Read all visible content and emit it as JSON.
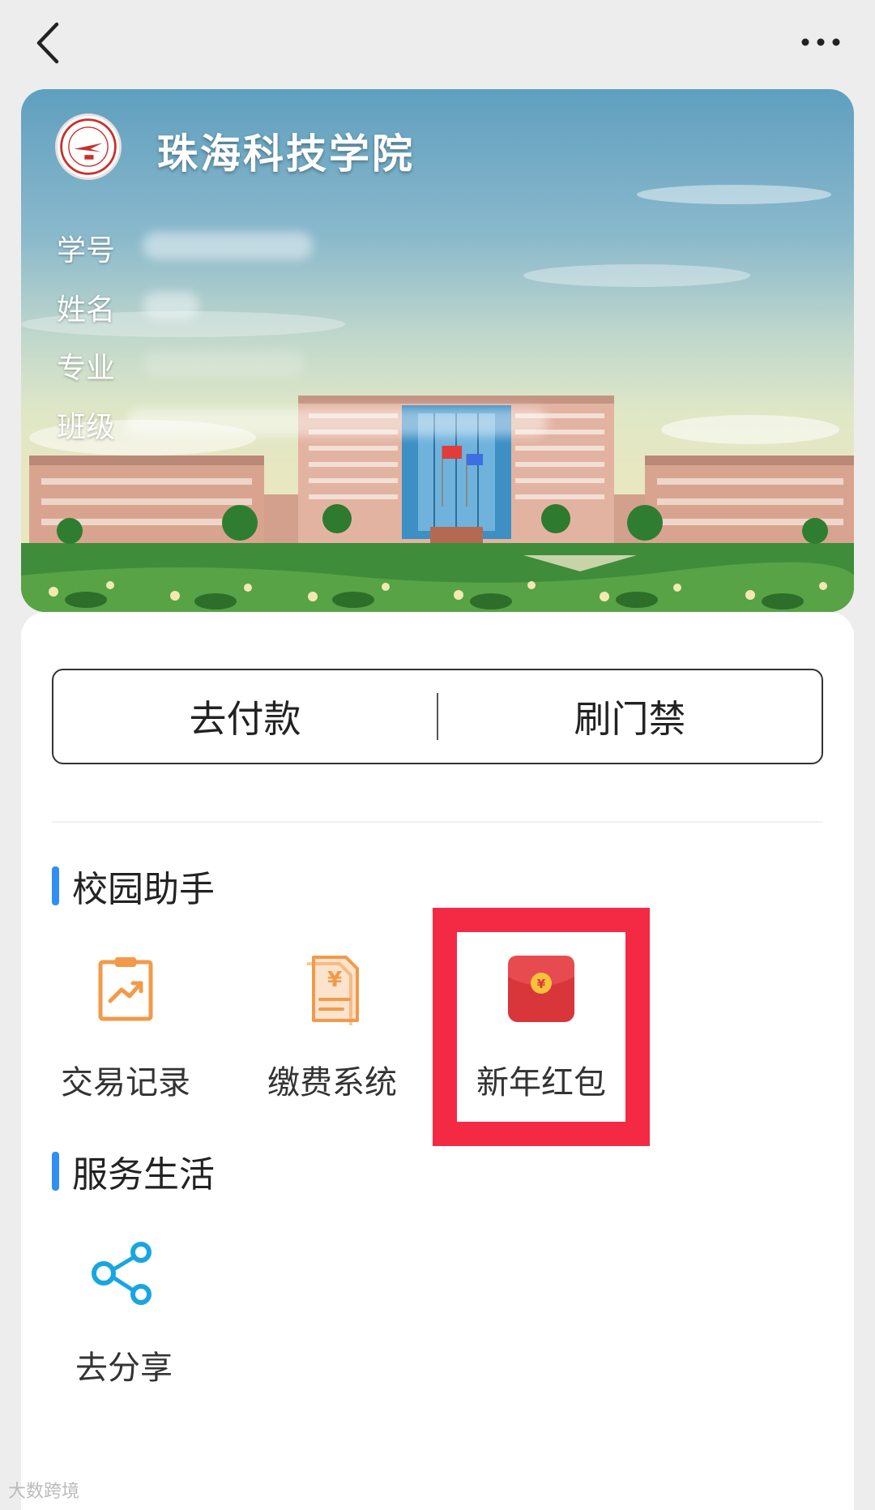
{
  "nav": {
    "back_icon": "chevron-left-icon",
    "more_icon": "more-dots-icon"
  },
  "card": {
    "school_name": "珠海科技学院",
    "logo_icon": "school-logo-icon",
    "fields": {
      "student_id_label": "学号",
      "name_label": "姓名",
      "major_label": "专业",
      "class_label": "班级"
    }
  },
  "actions": {
    "pay_label": "去付款",
    "access_label": "刷门禁"
  },
  "sections": {
    "campus_title": "校园助手",
    "service_title": "服务生活"
  },
  "campus_items": [
    {
      "label": "交易记录",
      "icon": "transaction-record-icon"
    },
    {
      "label": "缴费系统",
      "icon": "payment-system-icon"
    },
    {
      "label": "新年红包",
      "icon": "red-envelope-icon"
    }
  ],
  "service_items": [
    {
      "label": "去分享",
      "icon": "share-icon"
    }
  ],
  "colors": {
    "accent_blue": "#2f8ff2",
    "icon_orange": "#f29a4a",
    "icon_cyan": "#19a6e0",
    "highlight_red": "#f42a45",
    "envelope_red": "#d9363b"
  },
  "watermark": "大数跨境"
}
